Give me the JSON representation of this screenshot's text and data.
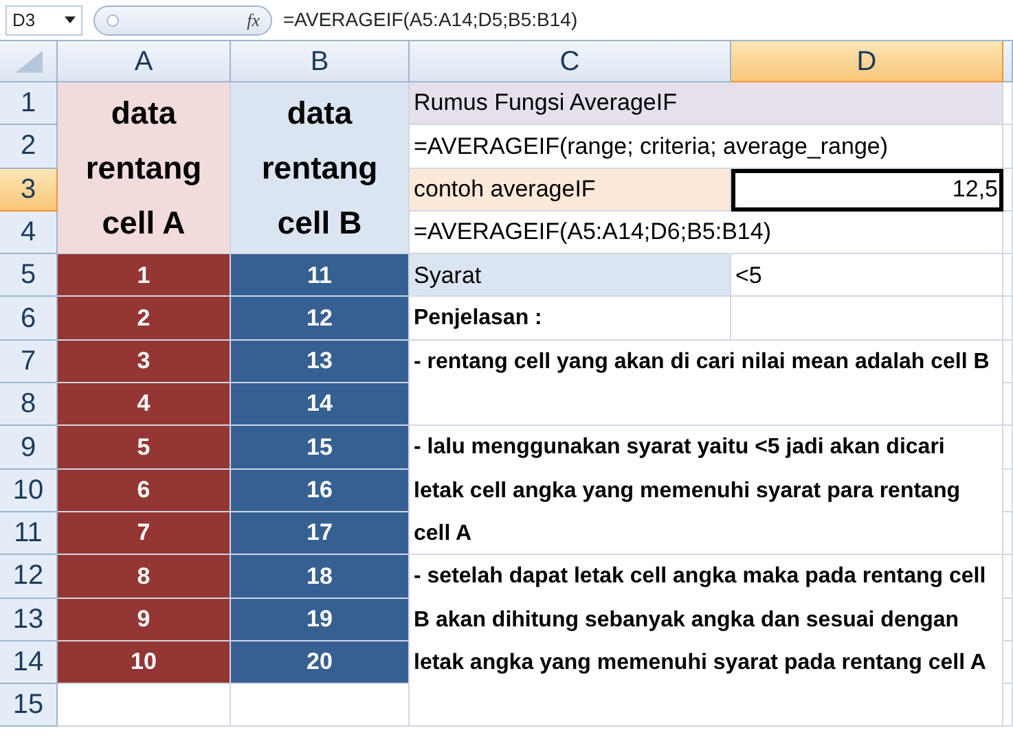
{
  "formula_bar": {
    "name_box": "D3",
    "function_label": "fx",
    "formula": "=AVERAGEIF(A5:A14;D5;B5:B14)"
  },
  "columns": [
    {
      "label": "A",
      "selected": false
    },
    {
      "label": "B",
      "selected": false
    },
    {
      "label": "C",
      "selected": false
    },
    {
      "label": "D",
      "selected": true
    }
  ],
  "rows": [
    {
      "label": "1",
      "selected": false
    },
    {
      "label": "2",
      "selected": false
    },
    {
      "label": "3",
      "selected": true
    },
    {
      "label": "4",
      "selected": false
    },
    {
      "label": "5",
      "selected": false
    },
    {
      "label": "6",
      "selected": false
    },
    {
      "label": "7",
      "selected": false
    },
    {
      "label": "8",
      "selected": false
    },
    {
      "label": "9",
      "selected": false
    },
    {
      "label": "10",
      "selected": false
    },
    {
      "label": "11",
      "selected": false
    },
    {
      "label": "12",
      "selected": false
    },
    {
      "label": "13",
      "selected": false
    },
    {
      "label": "14",
      "selected": false
    },
    {
      "label": "15",
      "selected": false
    }
  ],
  "range_a": {
    "header": {
      "text": "data rentang cell A",
      "color": "#f2dcdb"
    },
    "color": "#943634",
    "values": [
      "1",
      "2",
      "3",
      "4",
      "5",
      "6",
      "7",
      "8",
      "9",
      "10"
    ]
  },
  "range_b": {
    "header": {
      "text": "data rentang cell B",
      "color": "#dbe5f1"
    },
    "color": "#366092",
    "values": [
      "11",
      "12",
      "13",
      "14",
      "15",
      "16",
      "17",
      "18",
      "19",
      "20"
    ]
  },
  "info": [
    {
      "kind": "text",
      "text": "Rumus Fungsi AverageIF",
      "color": "#e5e0ec",
      "selected": false
    },
    {
      "kind": "text",
      "text": "=AVERAGEIF(range; criteria; average_range)",
      "selected": false
    },
    {
      "kind": "text",
      "text": "contoh averageIF",
      "color": "#fde9d9",
      "selected": false
    },
    {
      "kind": "value",
      "text": "12,5",
      "selected": true
    },
    {
      "kind": "text",
      "text": "=AVERAGEIF(A5:A14;D6;B5:B14)",
      "selected": false
    },
    {
      "kind": "text",
      "text": "Syarat",
      "color": "#dbe5f1",
      "selected": false
    },
    {
      "kind": "text",
      "text": "<5",
      "selected": false
    },
    {
      "kind": "note",
      "text": "Penjelasan :",
      "selected": false
    },
    {
      "kind": "note",
      "text": "- rentang cell yang akan di cari nilai mean adalah cell B",
      "selected": false
    },
    {
      "kind": "note",
      "text": "- lalu menggunakan syarat yaitu <5 jadi akan dicari letak cell angka yang memenuhi syarat para rentang cell A",
      "selected": false
    },
    {
      "kind": "note",
      "text": "- setelah dapat letak cell angka maka pada rentang cell B akan dihitung sebanyak angka dan sesuai dengan letak angka yang memenuhi syarat pada rentang cell A",
      "selected": false
    }
  ]
}
